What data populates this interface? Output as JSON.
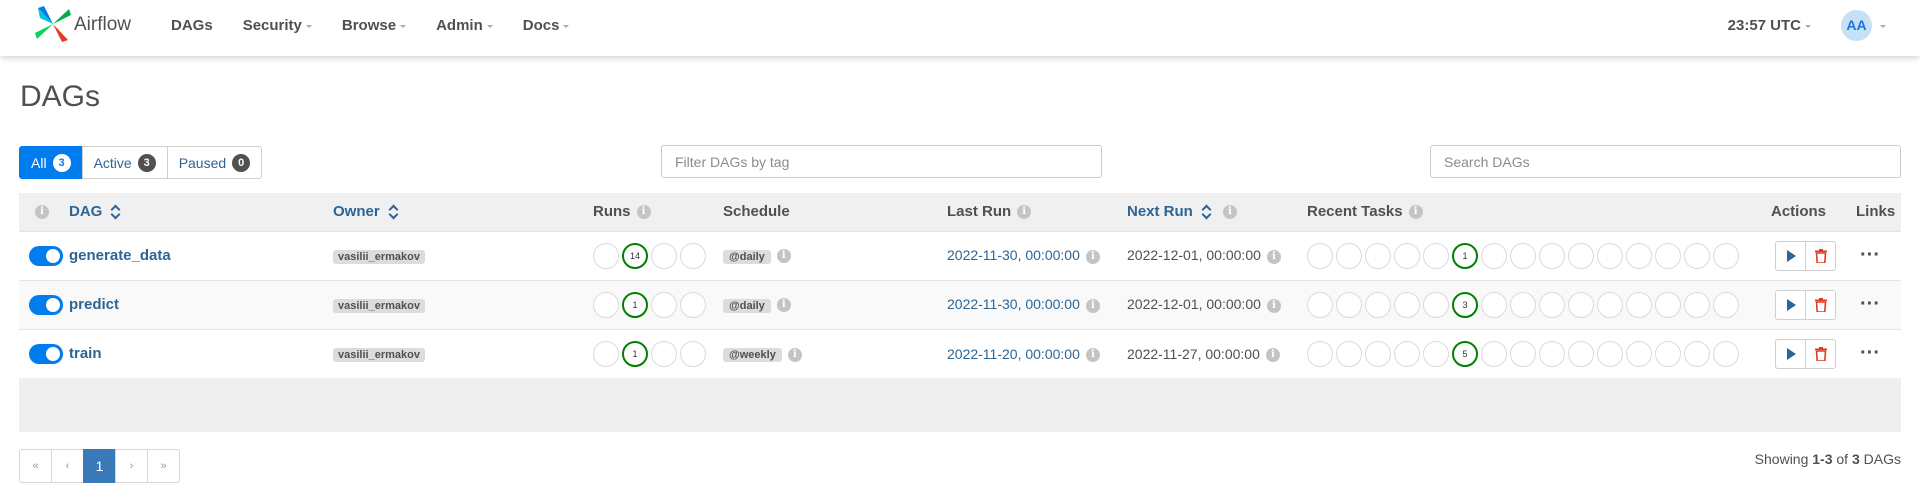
{
  "navbar": {
    "brand": "Airflow",
    "items": [
      {
        "label": "DAGs",
        "caret": false
      },
      {
        "label": "Security",
        "caret": true
      },
      {
        "label": "Browse",
        "caret": true
      },
      {
        "label": "Admin",
        "caret": true
      },
      {
        "label": "Docs",
        "caret": true
      }
    ],
    "clock": "23:57 UTC",
    "user_initials": "AA"
  },
  "page_title": "DAGs",
  "filters": {
    "all": {
      "label": "All",
      "count": "3"
    },
    "active": {
      "label": "Active",
      "count": "3"
    },
    "paused": {
      "label": "Paused",
      "count": "0"
    }
  },
  "tag_filter": {
    "placeholder": "Filter DAGs by tag"
  },
  "search": {
    "placeholder": "Search DAGs"
  },
  "table": {
    "headers": {
      "dag": "DAG",
      "owner": "Owner",
      "runs": "Runs",
      "schedule": "Schedule",
      "last_run": "Last Run",
      "next_run": "Next Run",
      "recent_tasks": "Recent Tasks",
      "actions": "Actions",
      "links": "Links"
    },
    "info_glyph": "i",
    "rows": [
      {
        "dag": "generate_data",
        "owner": "vasilii_ermakov",
        "runs_success": "14",
        "schedule": "@daily",
        "last_run": "2022-11-30, 00:00:00",
        "next_run": "2022-12-01, 00:00:00",
        "tasks_success": "1"
      },
      {
        "dag": "predict",
        "owner": "vasilii_ermakov",
        "runs_success": "1",
        "schedule": "@daily",
        "last_run": "2022-11-30, 00:00:00",
        "next_run": "2022-12-01, 00:00:00",
        "tasks_success": "3"
      },
      {
        "dag": "train",
        "owner": "vasilii_ermakov",
        "runs_success": "1",
        "schedule": "@weekly",
        "last_run": "2022-11-20, 00:00:00",
        "next_run": "2022-11-27, 00:00:00",
        "tasks_success": "5"
      }
    ]
  },
  "pagination": {
    "first": "«",
    "prev": "‹",
    "current": "1",
    "next": "›",
    "last": "»"
  },
  "showing": {
    "prefix": "Showing",
    "range": "1-3",
    "of": "of",
    "total": "3",
    "suffix": "DAGs"
  },
  "colors": {
    "primary": "#017cee",
    "link": "#2c6595",
    "success": "#008000",
    "delete": "#e43921"
  },
  "icons": {
    "play": "play-icon",
    "delete": "trash-icon",
    "more": "more-horizontal-icon",
    "info": "info-icon",
    "sort": "sort-icon"
  }
}
